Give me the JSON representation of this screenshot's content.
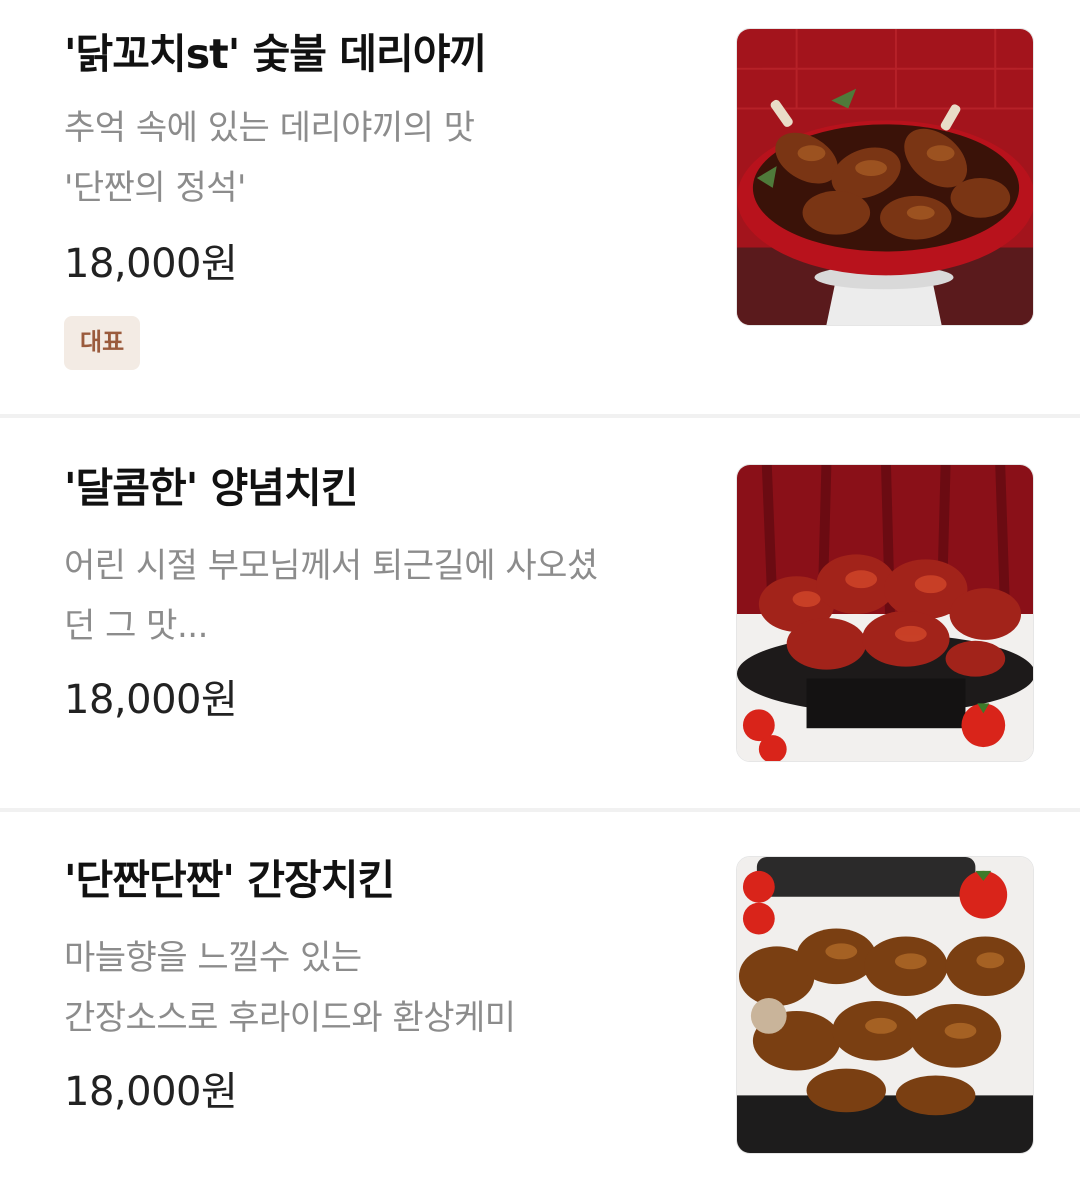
{
  "menu": {
    "items": [
      {
        "title": "'닭꼬치st' 숯불 데리야끼",
        "desc_lines": [
          "추억 속에 있는 데리야끼의 맛",
          "'단짠의 정석'"
        ],
        "price": "18,000원",
        "badge": "대표",
        "image_icon": "teriyaki-chicken-photo"
      },
      {
        "title": "'달콤한' 양념치킨",
        "desc_lines": [
          "어린 시절 부모님께서 퇴근길에 사오셨",
          "던 그 맛..."
        ],
        "price": "18,000원",
        "image_icon": "sweet-seasoned-chicken-photo"
      },
      {
        "title": "'단짠단짠' 간장치킨",
        "desc_lines": [
          "마늘향을 느낄수 있는",
          "간장소스로 후라이드와 환상케미"
        ],
        "price": "18,000원",
        "image_icon": "soy-sauce-chicken-photo"
      }
    ]
  },
  "colors": {
    "title": "#111111",
    "description": "#8c8c8c",
    "price": "#222222",
    "badge_bg": "#f3ebe4",
    "badge_text": "#9a5a3c",
    "divider": "#f1f1f1"
  }
}
